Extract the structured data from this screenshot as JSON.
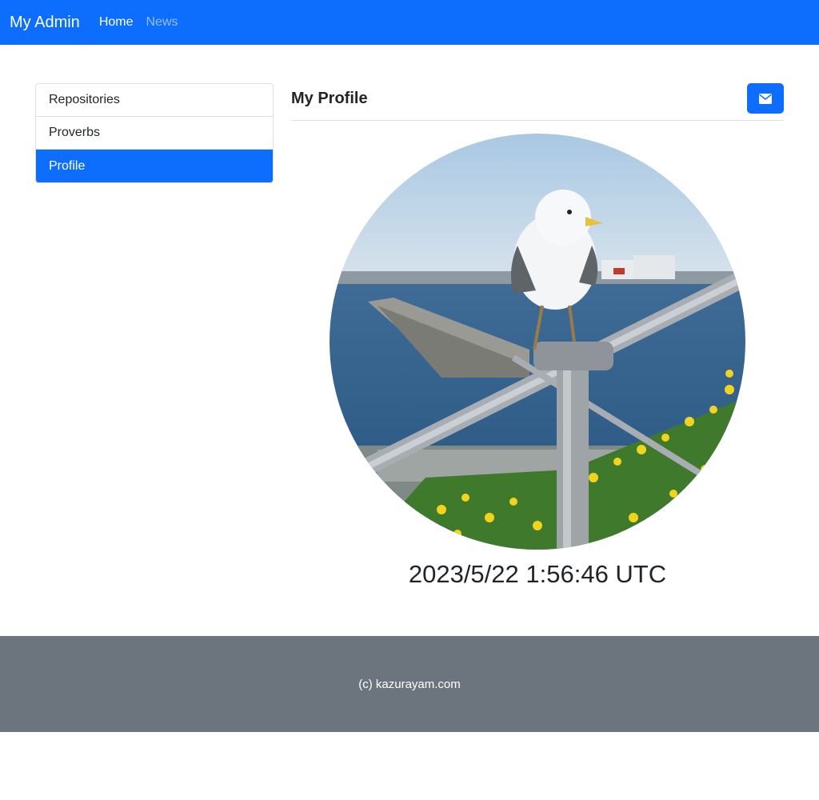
{
  "navbar": {
    "brand": "My Admin",
    "links": [
      {
        "label": "Home",
        "state": "active"
      },
      {
        "label": "News",
        "state": "muted"
      }
    ],
    "color": "#0d6efd"
  },
  "sidebar": {
    "items": [
      {
        "label": "Repositories",
        "active": false
      },
      {
        "label": "Proverbs",
        "active": false
      },
      {
        "label": "Profile",
        "active": true
      }
    ]
  },
  "main": {
    "title": "My Profile",
    "mail_icon": "envelope-icon",
    "avatar_subject": "seagull-on-railing-photo",
    "timestamp": "2023/5/22 1:56:46 UTC"
  },
  "footer": {
    "text": "(c) kazurayam.com",
    "color": "#6c757d"
  }
}
